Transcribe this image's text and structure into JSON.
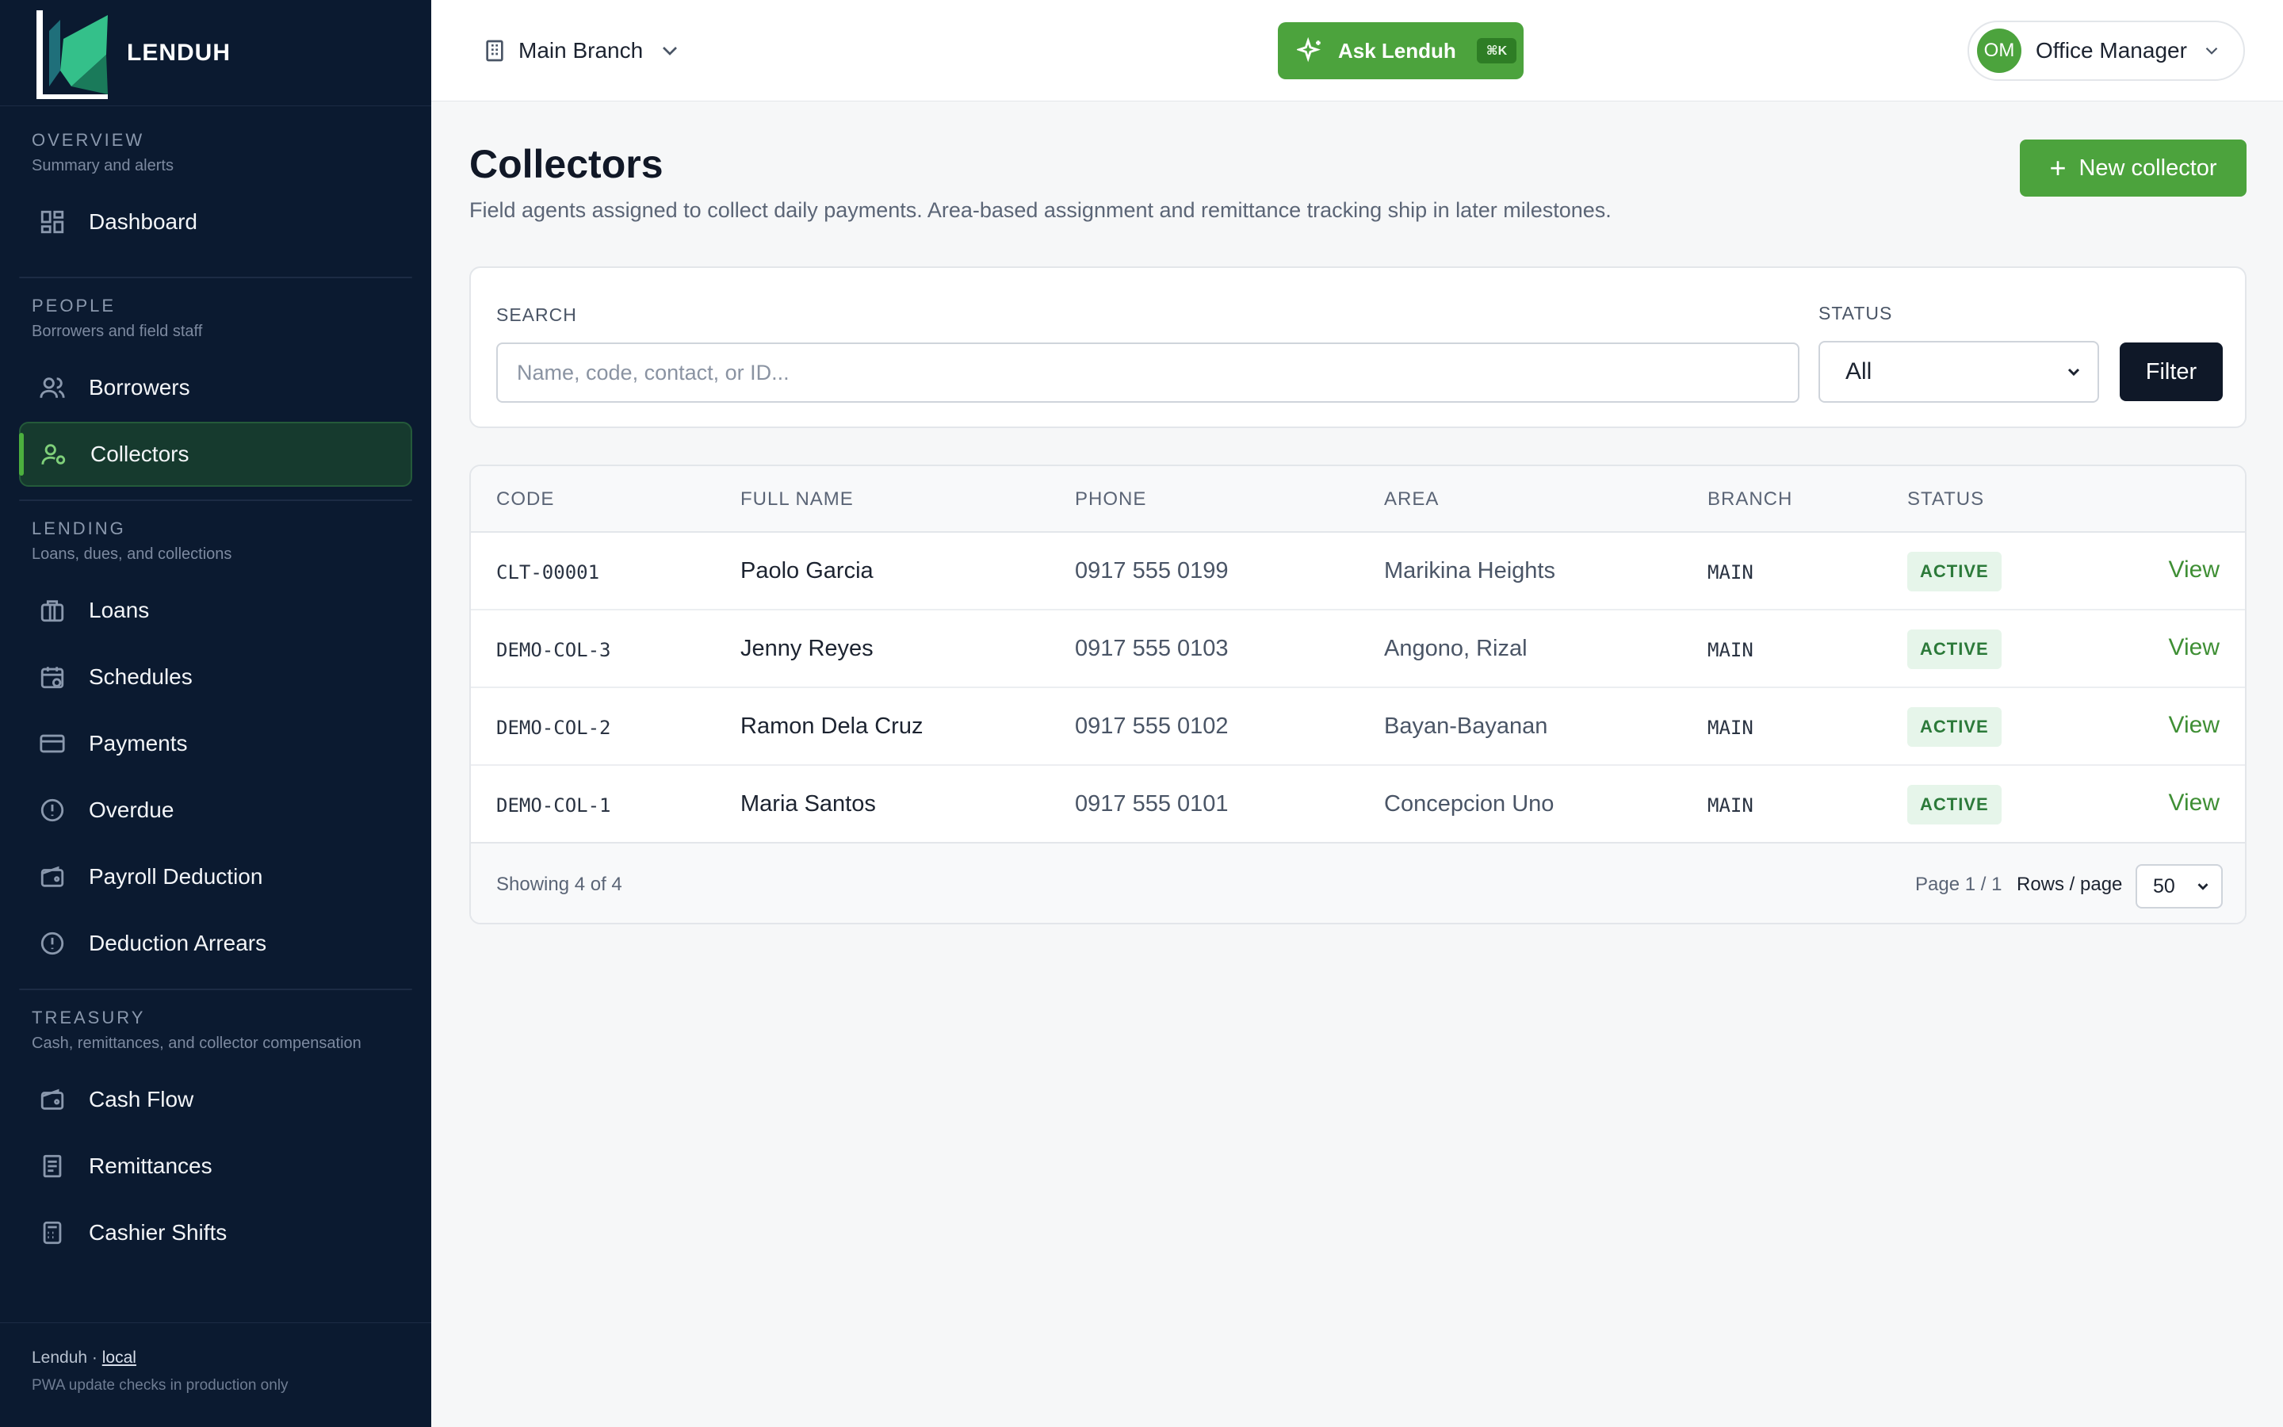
{
  "brand": {
    "name": "LENDUH"
  },
  "sidebar": {
    "sections": [
      {
        "title": "OVERVIEW",
        "subtitle": "Summary and alerts",
        "items": [
          {
            "label": "Dashboard",
            "icon": "dashboard-icon"
          }
        ]
      },
      {
        "title": "PEOPLE",
        "subtitle": "Borrowers and field staff",
        "items": [
          {
            "label": "Borrowers",
            "icon": "users-icon"
          },
          {
            "label": "Collectors",
            "icon": "user-gear-icon",
            "active": true
          }
        ]
      },
      {
        "title": "LENDING",
        "subtitle": "Loans, dues, and collections",
        "items": [
          {
            "label": "Loans",
            "icon": "briefcase-icon"
          },
          {
            "label": "Schedules",
            "icon": "calendar-clock-icon"
          },
          {
            "label": "Payments",
            "icon": "credit-card-icon"
          },
          {
            "label": "Overdue",
            "icon": "alert-circle-icon"
          },
          {
            "label": "Payroll Deduction",
            "icon": "wallet-icon"
          },
          {
            "label": "Deduction Arrears",
            "icon": "alert-circle-icon"
          }
        ]
      },
      {
        "title": "TREASURY",
        "subtitle": "Cash, remittances, and collector compensation",
        "items": [
          {
            "label": "Cash Flow",
            "icon": "wallet-icon"
          },
          {
            "label": "Remittances",
            "icon": "receipt-icon"
          },
          {
            "label": "Cashier Shifts",
            "icon": "calculator-icon"
          }
        ]
      }
    ],
    "footer": {
      "app": "Lenduh",
      "separator": " · ",
      "env": "local",
      "note": "PWA update checks in production only"
    }
  },
  "header": {
    "branch": "Main Branch",
    "ask_label": "Ask Lenduh",
    "ask_shortcut": "⌘K",
    "user_initials": "OM",
    "user_name": "Office Manager"
  },
  "page": {
    "title": "Collectors",
    "description": "Field agents assigned to collect daily payments. Area-based assignment and remittance tracking ship in later milestones.",
    "new_button": "New collector"
  },
  "filters": {
    "search_label": "SEARCH",
    "search_placeholder": "Name, code, contact, or ID...",
    "search_value": "",
    "status_label": "STATUS",
    "status_value": "All",
    "filter_button": "Filter"
  },
  "table": {
    "columns": [
      "CODE",
      "FULL NAME",
      "PHONE",
      "AREA",
      "BRANCH",
      "STATUS"
    ],
    "rows": [
      {
        "code": "CLT-00001",
        "name": "Paolo Garcia",
        "phone": "0917 555 0199",
        "area": "Marikina Heights",
        "branch": "MAIN",
        "status": "ACTIVE",
        "action": "View"
      },
      {
        "code": "DEMO-COL-3",
        "name": "Jenny Reyes",
        "phone": "0917 555 0103",
        "area": "Angono, Rizal",
        "branch": "MAIN",
        "status": "ACTIVE",
        "action": "View"
      },
      {
        "code": "DEMO-COL-2",
        "name": "Ramon Dela Cruz",
        "phone": "0917 555 0102",
        "area": "Bayan-Bayanan",
        "branch": "MAIN",
        "status": "ACTIVE",
        "action": "View"
      },
      {
        "code": "DEMO-COL-1",
        "name": "Maria Santos",
        "phone": "0917 555 0101",
        "area": "Concepcion Uno",
        "branch": "MAIN",
        "status": "ACTIVE",
        "action": "View"
      }
    ],
    "footer": {
      "showing": "Showing 4 of 4",
      "page_info": "Page 1 / 1",
      "rows_label": "Rows / page",
      "rows_value": "50"
    }
  },
  "colors": {
    "sidebar_bg": "#0b1a30",
    "accent": "#4ca33d",
    "active_bg": "#163a2e",
    "dark_button": "#0f1828"
  }
}
